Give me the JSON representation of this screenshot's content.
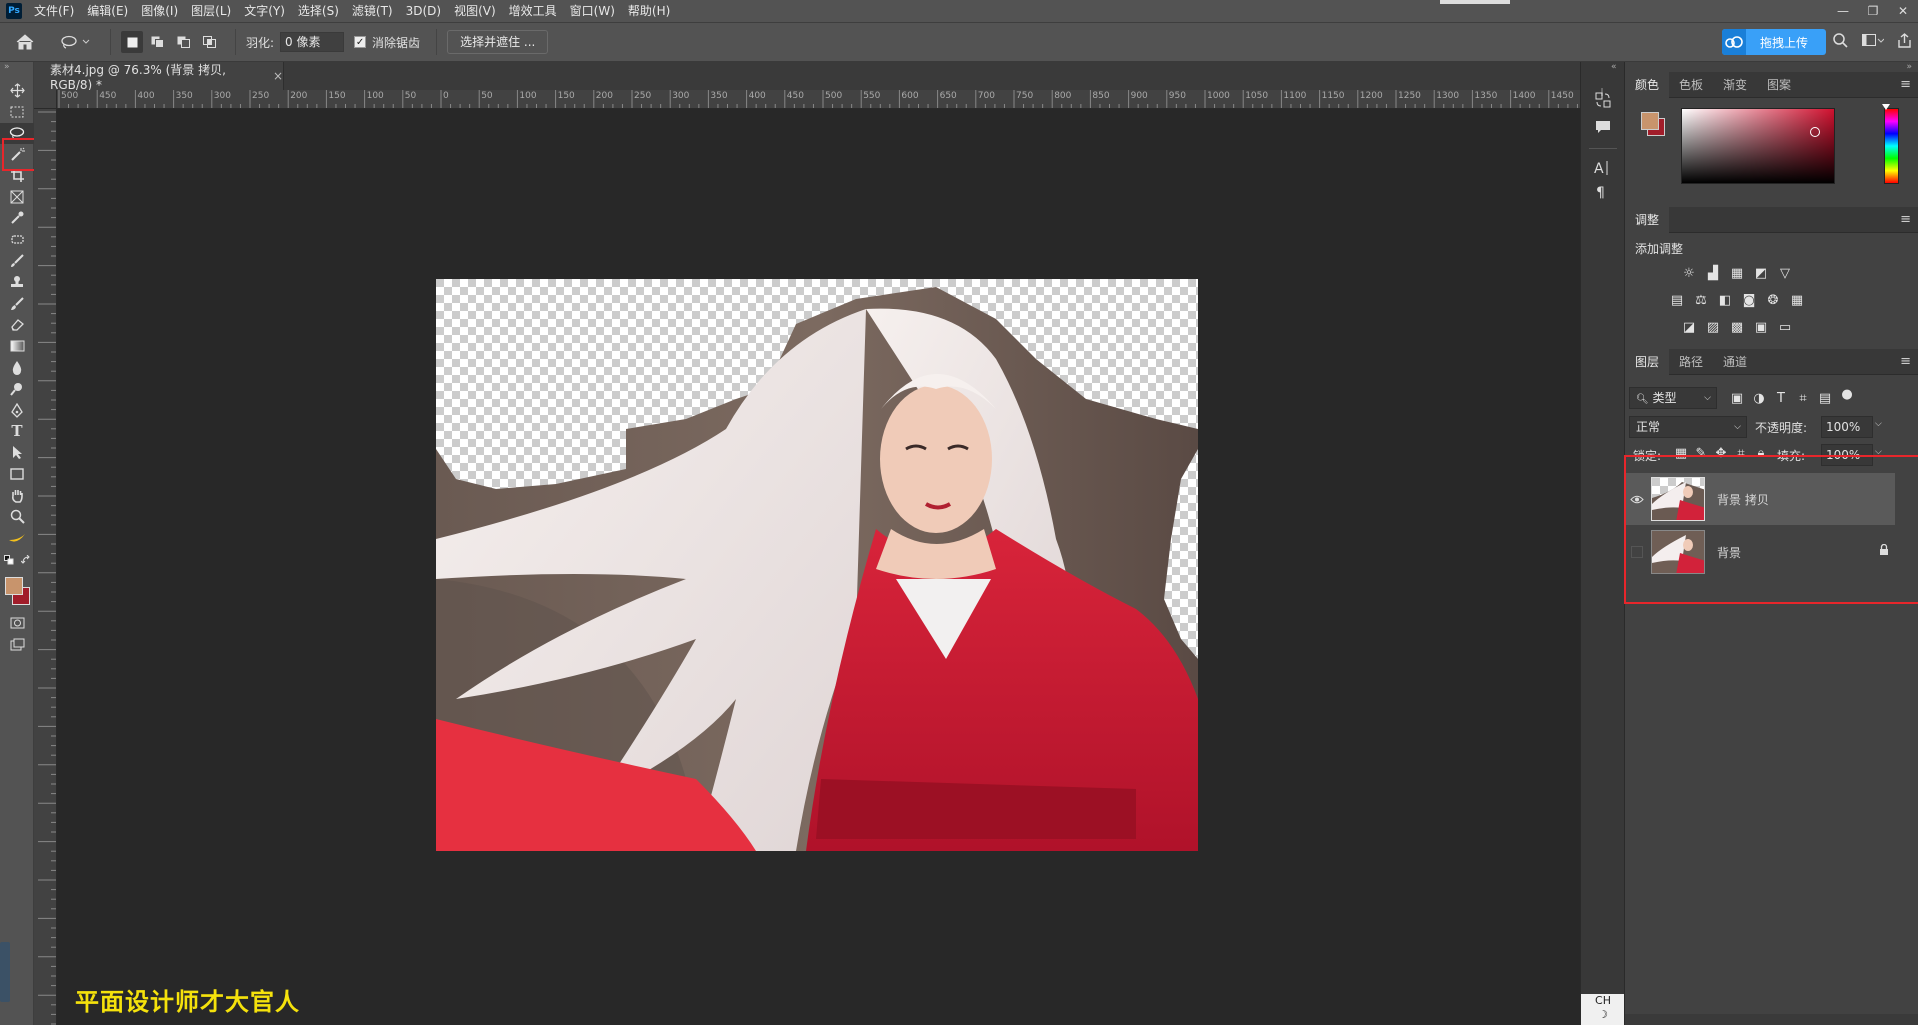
{
  "menu": {
    "logo": "Ps",
    "items": [
      "文件(F)",
      "编辑(E)",
      "图像(I)",
      "图层(L)",
      "文字(Y)",
      "选择(S)",
      "滤镜(T)",
      "3D(D)",
      "视图(V)",
      "增效工具",
      "窗口(W)",
      "帮助(H)"
    ],
    "window_controls": [
      "—",
      "❐",
      "✕"
    ]
  },
  "options": {
    "feather_label": "羽化:",
    "feather_value": "0 像素",
    "antialias_label": "消除锯齿",
    "antialias_checked": "✓",
    "select_mask_button": "选择并遮住 ...",
    "upload_button": "拖拽上传"
  },
  "document": {
    "tab_title": "素材4.jpg @ 76.3% (背景 拷贝, RGB/8) *",
    "tab_close": "×"
  },
  "ruler": {
    "h_labels": [
      "500",
      "450",
      "400",
      "350",
      "300",
      "250",
      "200",
      "150",
      "100",
      "50",
      "0",
      "50",
      "100",
      "150",
      "200",
      "250",
      "300",
      "350",
      "400",
      "450",
      "500",
      "550",
      "600",
      "650",
      "700",
      "750",
      "800",
      "850",
      "900",
      "950",
      "1000",
      "1050",
      "1100",
      "1150",
      "1200",
      "1250",
      "1300",
      "1350",
      "1400",
      "1450"
    ]
  },
  "watermark": "平面设计师才大官人",
  "panels": {
    "color_tabs": [
      "颜色",
      "色板",
      "渐变",
      "图案"
    ],
    "adjust_tab": "调整",
    "adjust_add_label": "添加调整",
    "layers_tabs": [
      "图层",
      "路径",
      "通道"
    ],
    "filter_kind": "类型",
    "blend_mode": "正常",
    "opacity_label": "不透明度:",
    "opacity_value": "100%",
    "lock_label": "锁定:",
    "fill_label": "填充:",
    "fill_value": "100%",
    "layers": [
      {
        "name": "背景 拷贝",
        "visible": true
      },
      {
        "name": "背景",
        "visible": false,
        "locked": true
      }
    ]
  },
  "ime": "CH",
  "colors": {
    "foreground": "#c8946c",
    "background": "#a11d2a",
    "highlight": "#e8262b",
    "watermark": "#f5e20c"
  }
}
